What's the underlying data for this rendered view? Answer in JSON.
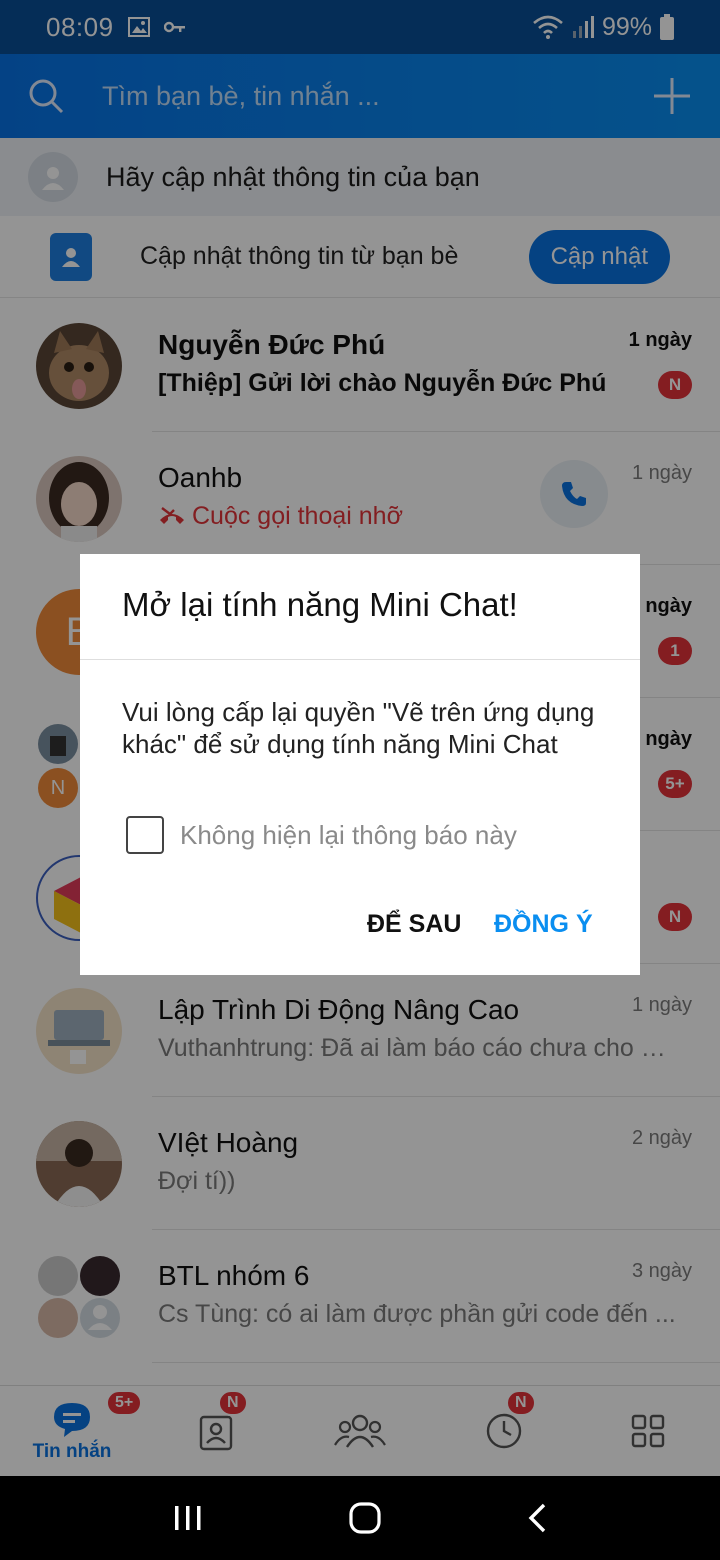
{
  "status_bar": {
    "time": "08:09",
    "battery": "99%"
  },
  "search": {
    "placeholder": "Tìm bạn bè, tin nhắn ..."
  },
  "profile_prompt": {
    "text": "Hãy cập nhật thông tin của bạn"
  },
  "friends_update": {
    "text": "Cập nhật thông tin từ bạn bè",
    "button": "Cập nhật"
  },
  "conversations": [
    {
      "name": "Nguyễn Đức Phú",
      "message": "[Thiệp] Gửi lời chào Nguyễn Đức Phú",
      "time": "1 ngày",
      "badge": "N",
      "unread": true
    },
    {
      "name": "Oanhb",
      "message": "Cuộc gọi thoại nhỡ",
      "time": "1 ngày",
      "missed_call": true
    },
    {
      "time": "ngày",
      "badge": "1",
      "avatar_letter": "B"
    },
    {
      "time": "ngày",
      "badge": "5+",
      "avatar_letter": "N"
    },
    {
      "badge": "N"
    },
    {
      "name": "Lập Trình Di Động Nâng Cao",
      "message": "Vuthanhtrung: Đã ai làm báo cáo chưa cho m...",
      "time": "1 ngày"
    },
    {
      "name": "VIệt Hoàng",
      "message": "Đợi tí))",
      "time": "2 ngày"
    },
    {
      "name": "BTL nhóm 6",
      "message": "Cs Tùng: có ai làm được phần gửi code đến ...",
      "time": "3 ngày"
    }
  ],
  "bottom_nav": {
    "messages_label": "Tin nhắn",
    "messages_badge": "5+",
    "contacts_badge": "N",
    "timeline_badge": "N"
  },
  "dialog": {
    "title": "Mở lại tính năng Mini Chat!",
    "body": "Vui lòng cấp lại quyền \"Vẽ trên ứng dụng khác\" để sử dụng tính năng Mini Chat",
    "checkbox_label": "Không hiện lại thông báo này",
    "later_button": "ĐỂ SAU",
    "ok_button": "ĐỒNG Ý"
  },
  "colors": {
    "primary": "#0a73e1",
    "header_dark": "#0a4e96",
    "badge": "#e4323a",
    "missed": "#e2343a"
  }
}
